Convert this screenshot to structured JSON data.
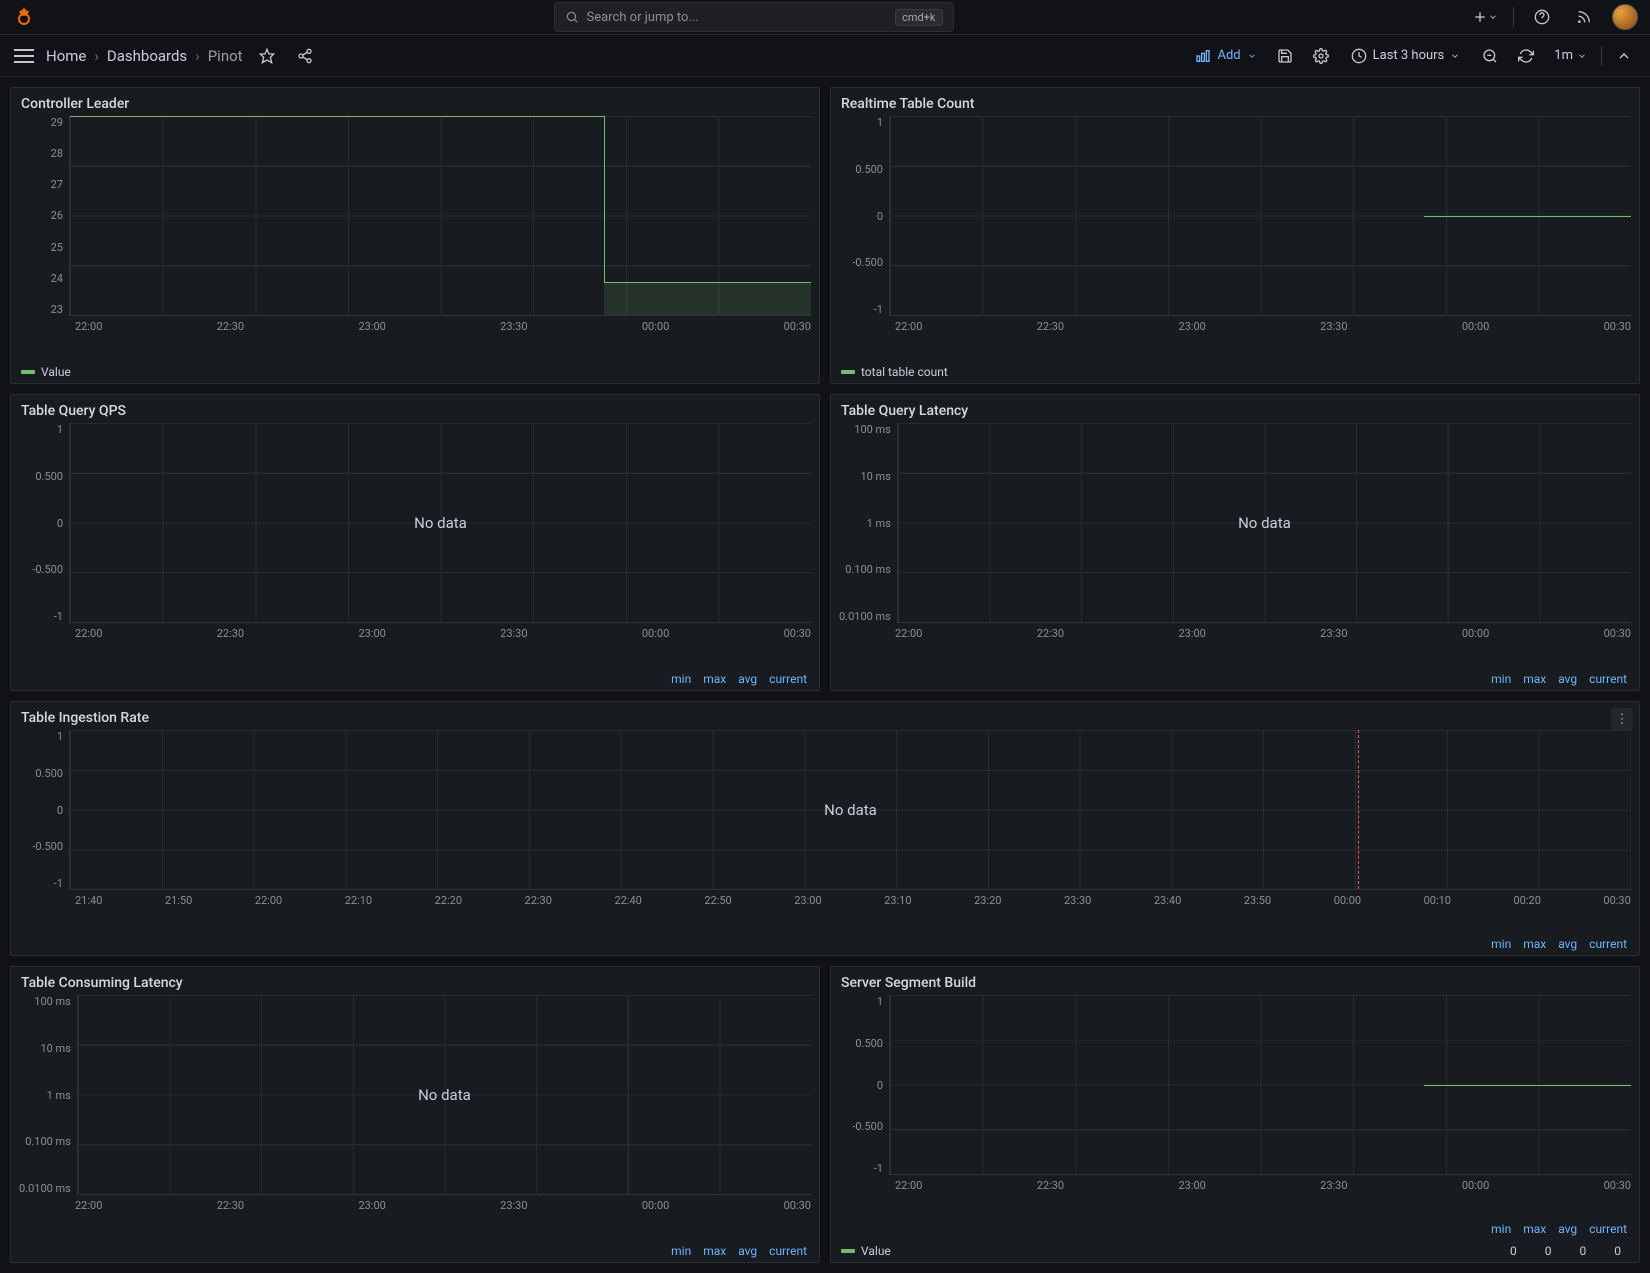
{
  "search": {
    "placeholder": "Search or jump to...",
    "kbd": "cmd+k"
  },
  "breadcrumb": {
    "home": "Home",
    "dashboards": "Dashboards",
    "current": "Pinot"
  },
  "nav": {
    "add": "Add",
    "timerange": "Last 3 hours",
    "interval": "1m"
  },
  "stats": {
    "min": "min",
    "max": "max",
    "avg": "avg",
    "current": "current"
  },
  "nodata": "No data",
  "panels": {
    "p1": {
      "title": "Controller Leader",
      "y": [
        "29",
        "28",
        "27",
        "26",
        "25",
        "24",
        "23"
      ],
      "x": [
        "22:00",
        "22:30",
        "23:00",
        "23:30",
        "00:00",
        "00:30"
      ],
      "legend": "Value"
    },
    "p2": {
      "title": "Realtime Table Count",
      "y": [
        "1",
        "0.500",
        "0",
        "-0.500",
        "-1"
      ],
      "x": [
        "22:00",
        "22:30",
        "23:00",
        "23:30",
        "00:00",
        "00:30"
      ],
      "legend": "total table count"
    },
    "p3": {
      "title": "Table Query QPS",
      "y": [
        "1",
        "0.500",
        "0",
        "-0.500",
        "-1"
      ],
      "x": [
        "22:00",
        "22:30",
        "23:00",
        "23:30",
        "00:00",
        "00:30"
      ]
    },
    "p4": {
      "title": "Table Query Latency",
      "y": [
        "100 ms",
        "10 ms",
        "1 ms",
        "0.100 ms",
        "0.0100 ms"
      ],
      "x": [
        "22:00",
        "22:30",
        "23:00",
        "23:30",
        "00:00",
        "00:30"
      ]
    },
    "p5": {
      "title": "Table Ingestion Rate",
      "y": [
        "1",
        "0.500",
        "0",
        "-0.500",
        "-1"
      ],
      "x": [
        "21:40",
        "21:50",
        "22:00",
        "22:10",
        "22:20",
        "22:30",
        "22:40",
        "22:50",
        "23:00",
        "23:10",
        "23:20",
        "23:30",
        "23:40",
        "23:50",
        "00:00",
        "00:10",
        "00:20",
        "00:30"
      ]
    },
    "p6": {
      "title": "Table Consuming Latency",
      "y": [
        "100 ms",
        "10 ms",
        "1 ms",
        "0.100 ms",
        "0.0100 ms"
      ],
      "x": [
        "22:00",
        "22:30",
        "23:00",
        "23:30",
        "00:00",
        "00:30"
      ]
    },
    "p7": {
      "title": "Server Segment Build",
      "y": [
        "1",
        "0.500",
        "0",
        "-0.500",
        "-1"
      ],
      "x": [
        "22:00",
        "22:30",
        "23:00",
        "23:30",
        "00:00",
        "00:30"
      ],
      "legend": "Value",
      "vals": {
        "min": "0",
        "max": "0",
        "avg": "0",
        "current": "0"
      }
    }
  },
  "chart_data": [
    {
      "panel": "Controller Leader",
      "type": "line",
      "ylim": [
        23,
        29
      ],
      "x_range": [
        "21:40",
        "00:40"
      ],
      "series": [
        {
          "name": "Value",
          "points": [
            {
              "x": "21:40",
              "y": 29
            },
            {
              "x": "23:47",
              "y": 29
            },
            {
              "x": "23:47",
              "y": 24
            },
            {
              "x": "00:40",
              "y": 24
            }
          ]
        }
      ]
    },
    {
      "panel": "Realtime Table Count",
      "type": "line",
      "ylim": [
        -1,
        1
      ],
      "x_range": [
        "21:40",
        "00:40"
      ],
      "series": [
        {
          "name": "total table count",
          "points": [
            {
              "x": "00:08",
              "y": 0
            },
            {
              "x": "00:40",
              "y": 0
            }
          ]
        }
      ]
    },
    {
      "panel": "Table Query QPS",
      "type": "line",
      "ylim": [
        -1,
        1
      ],
      "series": [],
      "note": "No data"
    },
    {
      "panel": "Table Query Latency",
      "type": "line",
      "yscale": "log",
      "ylim": [
        0.01,
        100
      ],
      "series": [],
      "note": "No data"
    },
    {
      "panel": "Table Ingestion Rate",
      "type": "line",
      "ylim": [
        -1,
        1
      ],
      "series": [],
      "note": "No data",
      "annotations": [
        {
          "type": "vline",
          "x": "00:12",
          "color": "red"
        }
      ]
    },
    {
      "panel": "Table Consuming Latency",
      "type": "line",
      "yscale": "log",
      "ylim": [
        0.01,
        100
      ],
      "series": [],
      "note": "No data"
    },
    {
      "panel": "Server Segment Build",
      "type": "line",
      "ylim": [
        -1,
        1
      ],
      "x_range": [
        "21:40",
        "00:40"
      ],
      "series": [
        {
          "name": "Value",
          "min": 0,
          "max": 0,
          "avg": 0,
          "current": 0,
          "points": [
            {
              "x": "00:08",
              "y": 0
            },
            {
              "x": "00:40",
              "y": 0
            }
          ]
        }
      ]
    }
  ]
}
